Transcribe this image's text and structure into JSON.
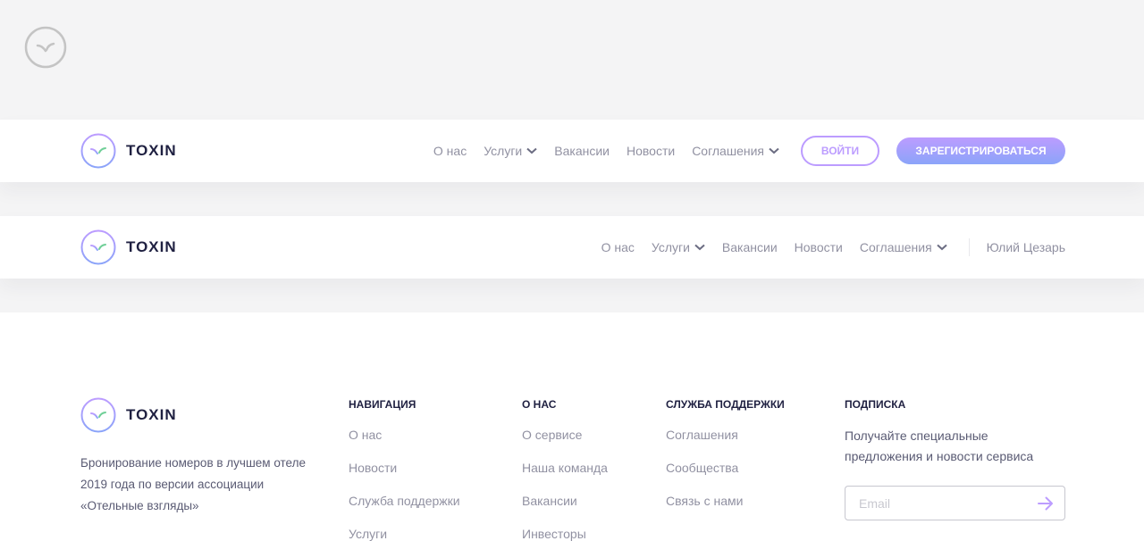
{
  "brand": {
    "name": "TOXIN",
    "accent_start": "#bc9cff",
    "accent_end": "#8ba4f9",
    "leaf_color": "#6fcf97"
  },
  "header_guest": {
    "nav": [
      {
        "label": "О нас"
      },
      {
        "label": "Услуги",
        "has_dropdown": true
      },
      {
        "label": "Вакансии"
      },
      {
        "label": "Новости"
      },
      {
        "label": "Соглашения",
        "has_dropdown": true
      }
    ],
    "login_label": "ВОЙТИ",
    "register_label": "ЗАРЕГИСТРИРОВАТЬСЯ"
  },
  "header_user": {
    "nav": [
      {
        "label": "О нас"
      },
      {
        "label": "Услуги",
        "has_dropdown": true
      },
      {
        "label": "Вакансии"
      },
      {
        "label": "Новости"
      },
      {
        "label": "Соглашения",
        "has_dropdown": true
      }
    ],
    "user_name": "Юлий Цезарь"
  },
  "footer": {
    "description": "Бронирование номеров в лучшем отеле 2019 года по версии ассоциации «Отельные взгляды»",
    "columns": [
      {
        "title": "НАВИГАЦИЯ",
        "links": [
          "О нас",
          "Новости",
          "Служба поддержки",
          "Услуги"
        ]
      },
      {
        "title": "О НАС",
        "links": [
          "О сервисе",
          "Наша команда",
          "Вакансии",
          "Инвесторы"
        ]
      },
      {
        "title": "СЛУЖБА ПОДДЕРЖКИ",
        "links": [
          "Соглашения",
          "Сообщества",
          "Связь с нами"
        ]
      }
    ],
    "subscription": {
      "title": "ПОДПИСКА",
      "text": "Получайте специальные предложения и новости сервиса",
      "email_placeholder": "Email",
      "email_value": ""
    }
  },
  "icons": {
    "logo": "toxin-logo-icon",
    "dropdown": "chevron-down-icon",
    "submit": "arrow-right-icon"
  }
}
